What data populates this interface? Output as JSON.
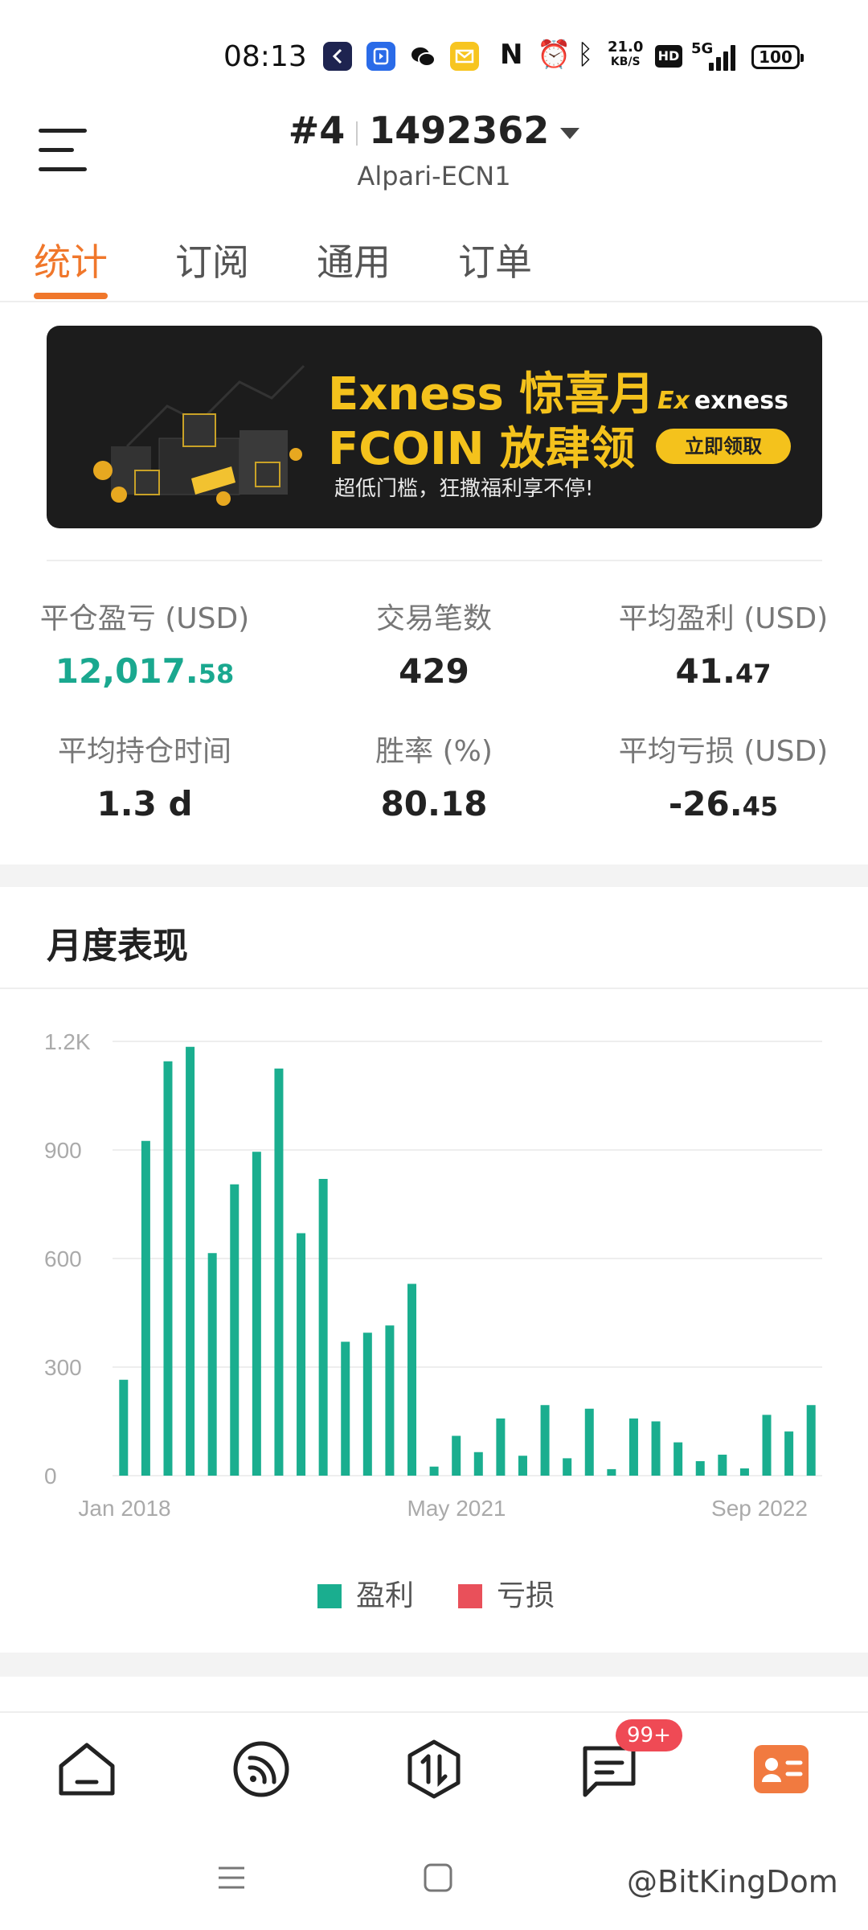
{
  "status_bar": {
    "time": "08:13",
    "net_speed_value": "21.0",
    "net_speed_unit": "KB/S",
    "hd": "HD",
    "network": "5G",
    "battery": "100"
  },
  "header": {
    "account_prefix": "#4",
    "account_number": "1492362",
    "server": "Alpari-ECN1"
  },
  "tabs": [
    {
      "label": "统计",
      "active": true
    },
    {
      "label": "订阅",
      "active": false
    },
    {
      "label": "通用",
      "active": false
    },
    {
      "label": "订单",
      "active": false
    }
  ],
  "banner": {
    "line1": "Exness 惊喜月",
    "line2": "FCOIN 放肆领",
    "subtitle": "超低门槛，狂撒福利享不停!",
    "brand": "exness",
    "brand_mark": "Ex",
    "cta": "立即领取"
  },
  "stats": {
    "closed_pnl": {
      "label": "平仓盈亏 (USD)",
      "int": "12,017.",
      "dec": "58"
    },
    "trades": {
      "label": "交易笔数",
      "value": "429"
    },
    "avg_profit": {
      "label": "平均盈利 (USD)",
      "int": "41.",
      "dec": "47"
    },
    "avg_hold": {
      "label": "平均持仓时间",
      "value": "1.3 d"
    },
    "win_rate": {
      "label": "胜率 (%)",
      "value": "80.18"
    },
    "avg_loss": {
      "label": "平均亏损 (USD)",
      "int": "-26.",
      "dec": "45"
    }
  },
  "monthly": {
    "title": "月度表现",
    "legend_profit": "盈利",
    "legend_loss": "亏损"
  },
  "colors": {
    "accent": "#f0772b",
    "profit": "#1aae8f",
    "loss": "#e9505a",
    "badge": "#ef4a55"
  },
  "chart_data": {
    "type": "bar",
    "ylim": [
      0,
      1200
    ],
    "yticks": [
      "0",
      "300",
      "600",
      "900",
      "1.2K"
    ],
    "xtick_labels": [
      "Jan 2018",
      "May 2021",
      "Sep 2022"
    ],
    "grid": true,
    "legend": "bottom-center",
    "series": [
      {
        "name": "盈利",
        "values": [
          265,
          925,
          1145,
          1185,
          615,
          805,
          895,
          1125,
          670,
          820,
          370,
          395,
          415,
          530,
          25,
          110,
          65,
          158,
          55,
          195,
          48,
          185,
          18,
          158,
          150,
          92,
          40,
          58,
          20,
          168,
          122,
          195
        ]
      },
      {
        "name": "亏损",
        "values": []
      }
    ]
  },
  "bottom_nav": {
    "badge": "99+",
    "items": [
      "home-icon",
      "feed-icon",
      "trade-icon",
      "message-icon",
      "profile-card-icon"
    ]
  },
  "watermark": "@BitKingDom"
}
